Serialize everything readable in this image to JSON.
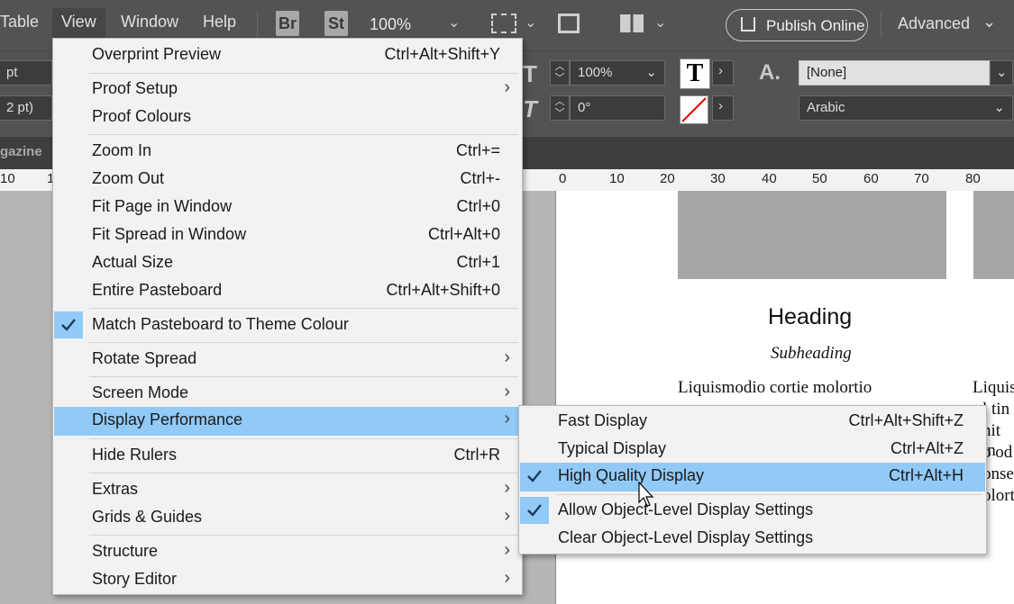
{
  "menubar": {
    "items": [
      "Table",
      "View",
      "Window",
      "Help"
    ],
    "badges": [
      "Br",
      "St"
    ],
    "zoom": "100%",
    "publish": "Publish Online",
    "workspace": "Advanced"
  },
  "control": {
    "pt1": "pt",
    "pt2": "2 pt)",
    "scale": "100%",
    "angle": "0°",
    "style": "[None]",
    "language": "Arabic",
    "char_glyph": "A.",
    "t_glyph": "T"
  },
  "tab": {
    "name": "gazine"
  },
  "ruler": {
    "left_ticks": [
      "10",
      "1"
    ],
    "ticks": [
      "0",
      "10",
      "20",
      "30",
      "40",
      "50",
      "60",
      "70",
      "80"
    ]
  },
  "doc": {
    "heading": "Heading",
    "subheading": "Subheading",
    "body_line": "Liquismodio cortie molortio",
    "right_col": [
      "Liquis",
      "l tin",
      "nit in",
      "o od",
      "onse",
      "olort"
    ]
  },
  "view_menu": {
    "items": [
      {
        "label": "Overprint Preview",
        "shortcut": "Ctrl+Alt+Shift+Y"
      },
      {
        "label": "Proof Setup",
        "shortcut": ""
      },
      {
        "label": "Proof Colours",
        "shortcut": ""
      },
      {
        "label": "Zoom In",
        "shortcut": "Ctrl+="
      },
      {
        "label": "Zoom Out",
        "shortcut": "Ctrl+-"
      },
      {
        "label": "Fit Page in Window",
        "shortcut": "Ctrl+0"
      },
      {
        "label": "Fit Spread in Window",
        "shortcut": "Ctrl+Alt+0"
      },
      {
        "label": "Actual Size",
        "shortcut": "Ctrl+1"
      },
      {
        "label": "Entire Pasteboard",
        "shortcut": "Ctrl+Alt+Shift+0"
      },
      {
        "label": "Match Pasteboard to Theme Colour",
        "shortcut": ""
      },
      {
        "label": "Rotate Spread",
        "shortcut": ""
      },
      {
        "label": "Screen Mode",
        "shortcut": ""
      },
      {
        "label": "Display Performance",
        "shortcut": ""
      },
      {
        "label": "Hide Rulers",
        "shortcut": "Ctrl+R"
      },
      {
        "label": "Extras",
        "shortcut": ""
      },
      {
        "label": "Grids & Guides",
        "shortcut": ""
      },
      {
        "label": "Structure",
        "shortcut": ""
      },
      {
        "label": "Story Editor",
        "shortcut": ""
      }
    ]
  },
  "display_submenu": {
    "items": [
      {
        "label": "Fast Display",
        "shortcut": "Ctrl+Alt+Shift+Z"
      },
      {
        "label": "Typical Display",
        "shortcut": "Ctrl+Alt+Z"
      },
      {
        "label": "High Quality Display",
        "shortcut": "Ctrl+Alt+H"
      },
      {
        "label": "Allow Object-Level Display Settings",
        "shortcut": ""
      },
      {
        "label": "Clear Object-Level Display Settings",
        "shortcut": ""
      }
    ]
  },
  "colors": {
    "highlight": "#91c9f7",
    "chrome": "#535353"
  }
}
